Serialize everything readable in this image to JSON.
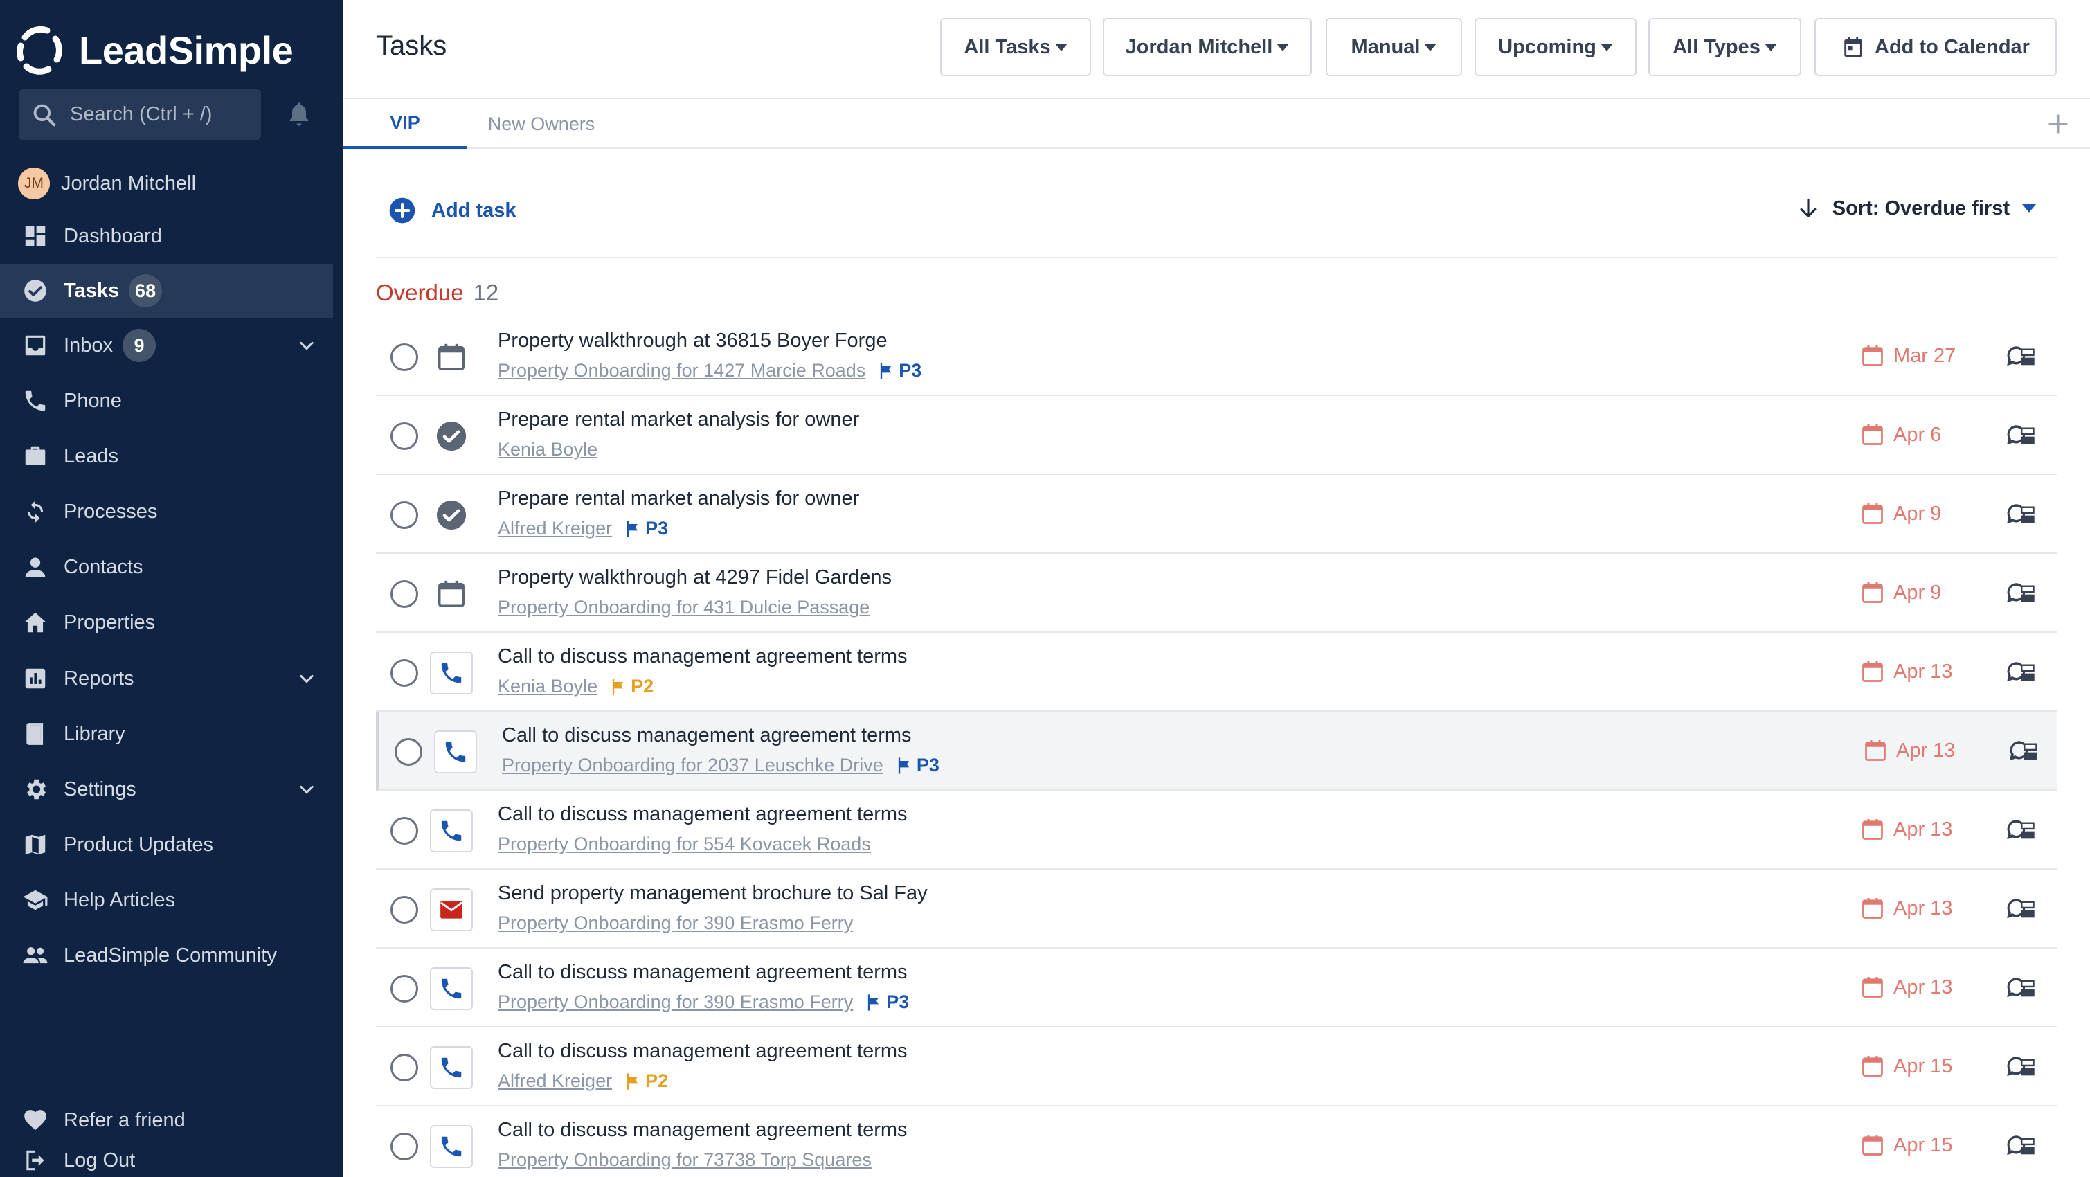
{
  "app": {
    "brand": "LeadSimple",
    "search_placeholder": "Search (Ctrl + /)",
    "user": {
      "name": "Jordan Mitchell",
      "initials": "JM"
    }
  },
  "sidebar": {
    "items": [
      {
        "label": "Dashboard",
        "icon": "dashboard-icon"
      },
      {
        "label": "Tasks",
        "icon": "check-circle-icon",
        "badge": "68",
        "active": true
      },
      {
        "label": "Inbox",
        "icon": "inbox-icon",
        "badge": "9",
        "expandable": true
      },
      {
        "label": "Phone",
        "icon": "phone-icon"
      },
      {
        "label": "Leads",
        "icon": "briefcase-icon"
      },
      {
        "label": "Processes",
        "icon": "refresh-icon"
      },
      {
        "label": "Contacts",
        "icon": "person-icon"
      },
      {
        "label": "Properties",
        "icon": "home-icon"
      },
      {
        "label": "Reports",
        "icon": "bar-chart-icon",
        "expandable": true
      },
      {
        "label": "Library",
        "icon": "book-icon"
      },
      {
        "label": "Settings",
        "icon": "gear-icon",
        "expandable": true
      },
      {
        "label": "Product Updates",
        "icon": "map-icon"
      },
      {
        "label": "Help Articles",
        "icon": "graduation-cap-icon"
      },
      {
        "label": "LeadSimple Community",
        "icon": "people-icon"
      }
    ],
    "footer": [
      {
        "label": "Refer a friend",
        "icon": "heart-icon"
      },
      {
        "label": "Log Out",
        "icon": "logout-icon"
      }
    ]
  },
  "header": {
    "title": "Tasks",
    "filters": [
      "All Tasks",
      "Jordan Mitchell",
      "Manual",
      "Upcoming",
      "All Types"
    ],
    "calendar_button": "Add to Calendar"
  },
  "tabs": [
    {
      "label": "VIP",
      "active": true
    },
    {
      "label": "New Owners",
      "active": false
    }
  ],
  "toolbar": {
    "add_task": "Add task",
    "sort": "Sort: Overdue first"
  },
  "section": {
    "name": "Overdue",
    "count": "12"
  },
  "tasks": [
    {
      "title": "Property walkthrough at 36815 Boyer Forge",
      "link": "Property Onboarding for 1427 Marcie Roads",
      "priority": "P3",
      "type": "calendar-icon",
      "due": "Mar 27"
    },
    {
      "title": "Prepare rental market analysis for owner",
      "link": "Kenia Boyle",
      "priority": "",
      "type": "check-circle-icon",
      "due": "Apr 6"
    },
    {
      "title": "Prepare rental market analysis for owner",
      "link": "Alfred Kreiger",
      "priority": "P3",
      "type": "check-circle-icon",
      "due": "Apr 9"
    },
    {
      "title": "Property walkthrough at 4297 Fidel Gardens",
      "link": "Property Onboarding for 431 Dulcie Passage",
      "priority": "",
      "type": "calendar-icon",
      "due": "Apr 9"
    },
    {
      "title": "Call to discuss management agreement terms",
      "link": "Kenia Boyle",
      "priority": "P2",
      "type": "phone-icon",
      "due": "Apr 13"
    },
    {
      "title": "Call to discuss management agreement terms",
      "link": "Property Onboarding for 2037 Leuschke Drive",
      "priority": "P3",
      "type": "phone-icon",
      "due": "Apr 13",
      "hover": true
    },
    {
      "title": "Call to discuss management agreement terms",
      "link": "Property Onboarding for 554 Kovacek Roads",
      "priority": "",
      "type": "phone-icon",
      "due": "Apr 13"
    },
    {
      "title": "Send property management brochure to Sal Fay",
      "link": "Property Onboarding for 390 Erasmo Ferry",
      "priority": "",
      "type": "email-icon",
      "due": "Apr 13"
    },
    {
      "title": "Call to discuss management agreement terms",
      "link": "Property Onboarding for 390 Erasmo Ferry",
      "priority": "P3",
      "type": "phone-icon",
      "due": "Apr 13"
    },
    {
      "title": "Call to discuss management agreement terms",
      "link": "Alfred Kreiger",
      "priority": "P2",
      "type": "phone-icon",
      "due": "Apr 15"
    },
    {
      "title": "Call to discuss management agreement terms",
      "link": "Property Onboarding for 73738 Torp Squares",
      "priority": "",
      "type": "phone-icon",
      "due": "Apr 15"
    }
  ],
  "colors": {
    "sidebar_bg": "#0f2442",
    "accent": "#1a56b0",
    "overdue": "#c43a2a",
    "due_date": "#e07a70",
    "priority_p2": "#e5a024",
    "priority_p3": "#1a56b0"
  }
}
